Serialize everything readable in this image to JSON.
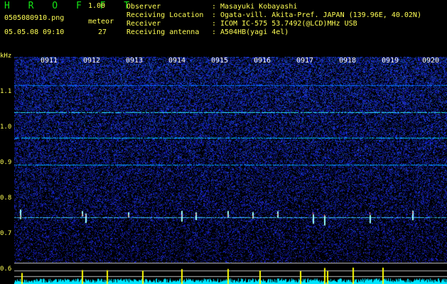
{
  "header": {
    "app_title": "H R O F F T",
    "version": "1.00",
    "file_name": "0505080910.png",
    "datetime": "05.05.08 09:10",
    "meteor_label": "meteor",
    "meteor_count": "27",
    "info": [
      {
        "key": "Observer",
        "value": "Masayuki Kobayashi"
      },
      {
        "key": "Receiving Location",
        "value": "Ogata-vill. Akita-Pref. JAPAN (139.96E, 40.02N)"
      },
      {
        "key": "Receiver",
        "value": "ICOM IC-575 53.7492(@LCD)MHz USB"
      },
      {
        "key": "Receiving antenna",
        "value": "A504HB(yagi 4el)"
      }
    ],
    "separator": ":"
  },
  "axis": {
    "unit": "kHz",
    "y_labels": [
      "1.1",
      "1.0",
      "0.9",
      "0.8",
      "0.7",
      "0.6"
    ],
    "time_labels": [
      "0911",
      "0912",
      "0913",
      "0914",
      "0915",
      "0916",
      "0917",
      "0918",
      "0919",
      "0920"
    ]
  },
  "colors": {
    "background": "#000000",
    "noise": "#1a2dc8",
    "signal": "#00e5ff",
    "text": "#ffff55",
    "title": "#16e516"
  }
}
